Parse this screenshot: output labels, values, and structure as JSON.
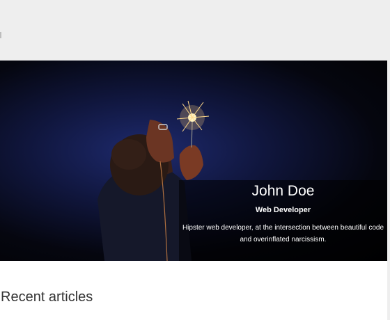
{
  "nav": {
    "link_label": "e"
  },
  "hero": {
    "name": "John Doe",
    "role": "Web Developer",
    "bio_line1": "Hipster web developer, at the intersection between beautiful code",
    "bio_line2": "and overinflated narcissism."
  },
  "main": {
    "section_title": "Recent articles"
  },
  "colors": {
    "hero_glow": "#1e2a6e",
    "hero_bg": "#020203",
    "page_bg": "#eeeeee"
  }
}
